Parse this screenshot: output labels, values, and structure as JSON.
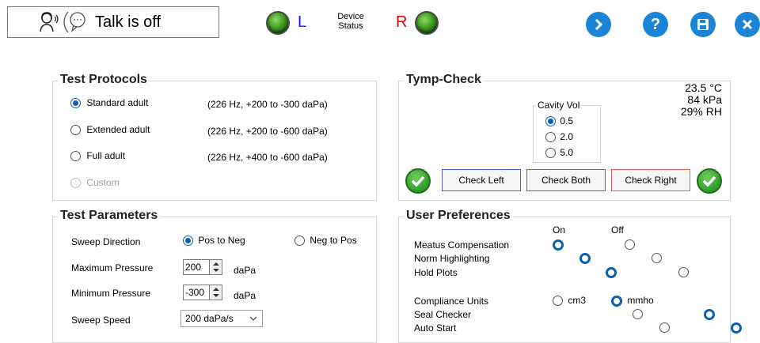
{
  "header": {
    "talk_status": "Talk is off",
    "left_label": "L",
    "right_label": "R",
    "device_status_line1": "Device",
    "device_status_line2": "Status",
    "colors": {
      "left": "#1a1aff",
      "right": "#e0000a",
      "accent": "#1c84d6"
    }
  },
  "test_protocols": {
    "title": "Test Protocols",
    "items": [
      {
        "label": "Standard adult",
        "detail": "(226 Hz, +200 to -300 daPa)",
        "selected": true
      },
      {
        "label": "Extended adult",
        "detail": "(226 Hz, +200 to -600 daPa)",
        "selected": false
      },
      {
        "label": "Full adult",
        "detail": "(226 Hz, +400 to -600 daPa)",
        "selected": false
      },
      {
        "label": "Custom",
        "detail": "",
        "selected": false,
        "disabled": true
      }
    ]
  },
  "tymp_check": {
    "title": "Tymp-Check",
    "temperature": "23.5 °C",
    "pressure": "84 kPa",
    "humidity": "29% RH",
    "cavity_vol": {
      "title": "Cavity Vol",
      "options": [
        "0.5",
        "2.0",
        "5.0"
      ],
      "selected": "0.5"
    },
    "check_left": "Check Left",
    "check_both": "Check Both",
    "check_right": "Check Right"
  },
  "test_parameters": {
    "title": "Test Parameters",
    "sweep_direction_label": "Sweep Direction",
    "sweep_options": [
      "Pos to Neg",
      "Neg to Pos"
    ],
    "sweep_selected": "Pos to Neg",
    "max_pressure_label": "Maximum Pressure",
    "max_pressure_value": "200",
    "min_pressure_label": "Minimum Pressure",
    "min_pressure_value": "-300",
    "unit": "daPa",
    "sweep_speed_label": "Sweep Speed",
    "sweep_speed_value": "200 daPa/s"
  },
  "user_preferences": {
    "title": "User Preferences",
    "on_label": "On",
    "off_label": "Off",
    "toggles": [
      {
        "label": "Meatus Compensation",
        "value": "On"
      },
      {
        "label": "Norm Highlighting",
        "value": "On"
      },
      {
        "label": "Hold Plots",
        "value": "On"
      }
    ],
    "compliance_units_label": "Compliance Units",
    "compliance_units_options": [
      "cm3",
      "mmho"
    ],
    "compliance_units_selected": "mmho",
    "seal_checker_label": "Seal Checker",
    "seal_checker_value": "Off",
    "auto_start_label": "Auto Start",
    "auto_start_value": "Off"
  }
}
